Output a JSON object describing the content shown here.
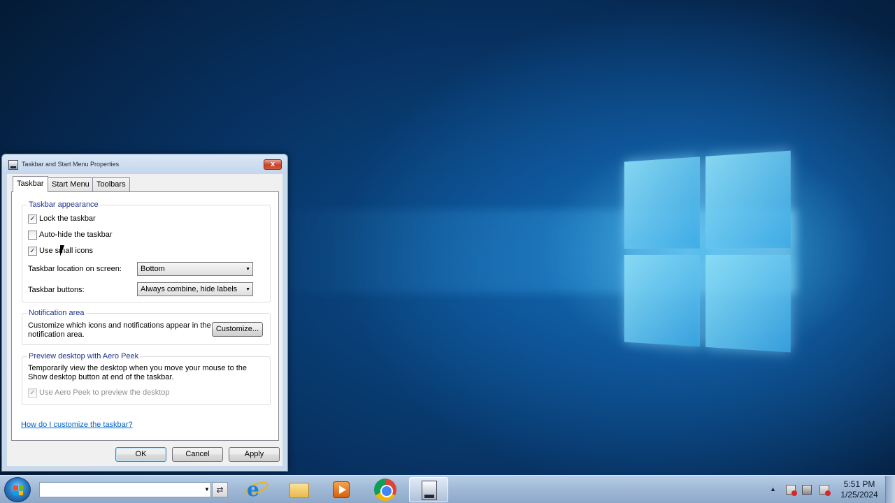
{
  "dialog": {
    "title": "Taskbar and Start Menu Properties",
    "close_label": "x",
    "tabs": [
      {
        "label": "Taskbar",
        "active": true
      },
      {
        "label": "Start Menu",
        "active": false
      },
      {
        "label": "Toolbars",
        "active": false
      }
    ],
    "appearance": {
      "title": "Taskbar appearance",
      "lock": {
        "label": "Lock the taskbar",
        "checked": true
      },
      "autohide": {
        "label": "Auto-hide the taskbar",
        "checked": false
      },
      "small_icons": {
        "label": "Use small icons",
        "checked": true
      },
      "location_label": "Taskbar location on screen:",
      "location_value": "Bottom",
      "buttons_label": "Taskbar buttons:",
      "buttons_value": "Always combine, hide labels"
    },
    "notification": {
      "title": "Notification area",
      "description_line1": "Customize which icons and notifications appear in the",
      "description_line2": "notification area.",
      "customize_label": "Customize..."
    },
    "aero_peek": {
      "title": "Preview desktop with Aero Peek",
      "description_line1": "Temporarily view the desktop when you move your mouse to the",
      "description_line2": "Show desktop button at end of the taskbar.",
      "checkbox": {
        "label": "Use Aero Peek to preview the desktop",
        "checked": true,
        "disabled": true
      }
    },
    "help_link": "How do I customize the taskbar?",
    "buttons": {
      "ok": "OK",
      "cancel": "Cancel",
      "apply": "Apply"
    }
  },
  "checkmark": "✓",
  "taskbar": {
    "address_value": "",
    "tray": {
      "time": "5:51 PM",
      "date": "1/25/2024"
    }
  },
  "icons": {
    "start": "windows-start-icon",
    "ie": "internet-explorer-icon",
    "explorer": "file-explorer-icon",
    "media": "media-player-icon",
    "chrome": "chrome-icon",
    "properties": "taskbar-properties-icon",
    "network": "network-icon",
    "monitor": "monitor-icon",
    "volume": "volume-icon"
  },
  "colors": {
    "link": "#0066cc",
    "close_button": "#c7432a",
    "desktop_glow": "#46bef0"
  }
}
